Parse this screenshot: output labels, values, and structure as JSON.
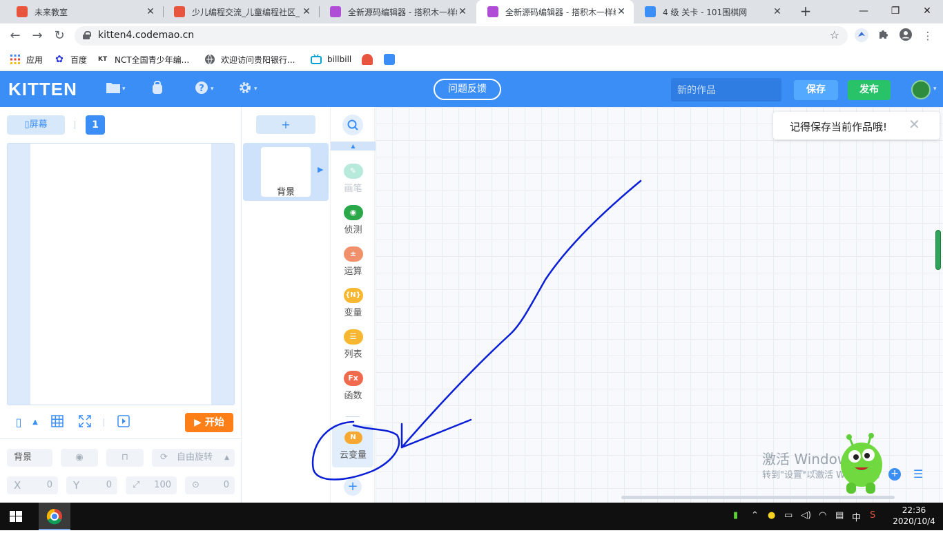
{
  "browser": {
    "tabs": [
      {
        "title": "未来教室",
        "favicon_color": "#e8553f"
      },
      {
        "title": "少儿编程交流_儿童编程社区_",
        "favicon_color": "#e8553f"
      },
      {
        "title": "全新源码编辑器 - 搭积木一样编",
        "favicon_color": "#b04dd6"
      },
      {
        "title": "全新源码编辑器 - 搭积木一样编",
        "favicon_color": "#b04dd6",
        "active": true
      },
      {
        "title": "4 级 关卡 - 101围棋网",
        "favicon_color": "#3a8ef6"
      }
    ],
    "new_tab": "+",
    "window_controls": [
      "—",
      "❐",
      "✕"
    ],
    "url": "kitten4.codemao.cn",
    "bookmarks": [
      {
        "label": "应用",
        "icon": "apps-grid-icon",
        "color": "#4285f4"
      },
      {
        "label": "百度",
        "icon": "paw-icon",
        "color": "#2932e1"
      },
      {
        "label": "NCT全国青少年编...",
        "icon": "nct-icon",
        "color": "#333333"
      },
      {
        "label": "欢迎访问贵阳银行...",
        "icon": "globe-icon",
        "color": "#5f6368"
      },
      {
        "label": "billbill",
        "icon": "tv-icon",
        "color": "#00a1d6"
      },
      {
        "label": "",
        "icon": "codemao-icon",
        "color": "#e8553f"
      },
      {
        "label": "",
        "icon": "kitten-icon",
        "color": "#3a8ef6"
      }
    ]
  },
  "app": {
    "logo": "KITTEN",
    "header_icons": [
      "folder-icon",
      "backpack-icon",
      "help-icon",
      "settings-icon"
    ],
    "feedback_label": "问题反馈",
    "work_name_placeholder": "新的作品",
    "save_label": "保存",
    "publish_label": "发布"
  },
  "stage": {
    "screen_label": "屏幕",
    "page_number": "1",
    "start_label": "开始",
    "props": {
      "name": "背景",
      "rotate_label": "自由旋转",
      "x_label": "X",
      "x_value": "0",
      "y_label": "Y",
      "y_value": "0",
      "size_value": "100",
      "direction_value": "0"
    }
  },
  "sprites": {
    "add_label": "+",
    "items": [
      {
        "name": "背景"
      }
    ]
  },
  "categories": [
    {
      "label": "画笔",
      "color": "#36c49a",
      "icon": "pen-icon",
      "glyph": "✎",
      "faded": true
    },
    {
      "label": "侦测",
      "color": "#2aa84a",
      "icon": "detect-icon",
      "glyph": "◉"
    },
    {
      "label": "运算",
      "color": "#f0916b",
      "icon": "calc-icon",
      "glyph": "±"
    },
    {
      "label": "变量",
      "color": "#f7b731",
      "icon": "variable-icon",
      "glyph": "{N}"
    },
    {
      "label": "列表",
      "color": "#f7b731",
      "icon": "list-icon",
      "glyph": "☰"
    },
    {
      "label": "函数",
      "color": "#f06a4e",
      "icon": "function-icon",
      "glyph": "Fx"
    },
    {
      "label": "云变量",
      "color": "#f7a832",
      "icon": "cloud-variable-icon",
      "glyph": "N"
    }
  ],
  "workspace": {
    "toast": "记得保存当前作品哦!",
    "watermark_title": "激活 Windows",
    "watermark_sub": "转到\"设置\"以激活 Windows。"
  },
  "taskbar": {
    "ime": "中",
    "time": "22:36",
    "date": "2020/10/4"
  }
}
